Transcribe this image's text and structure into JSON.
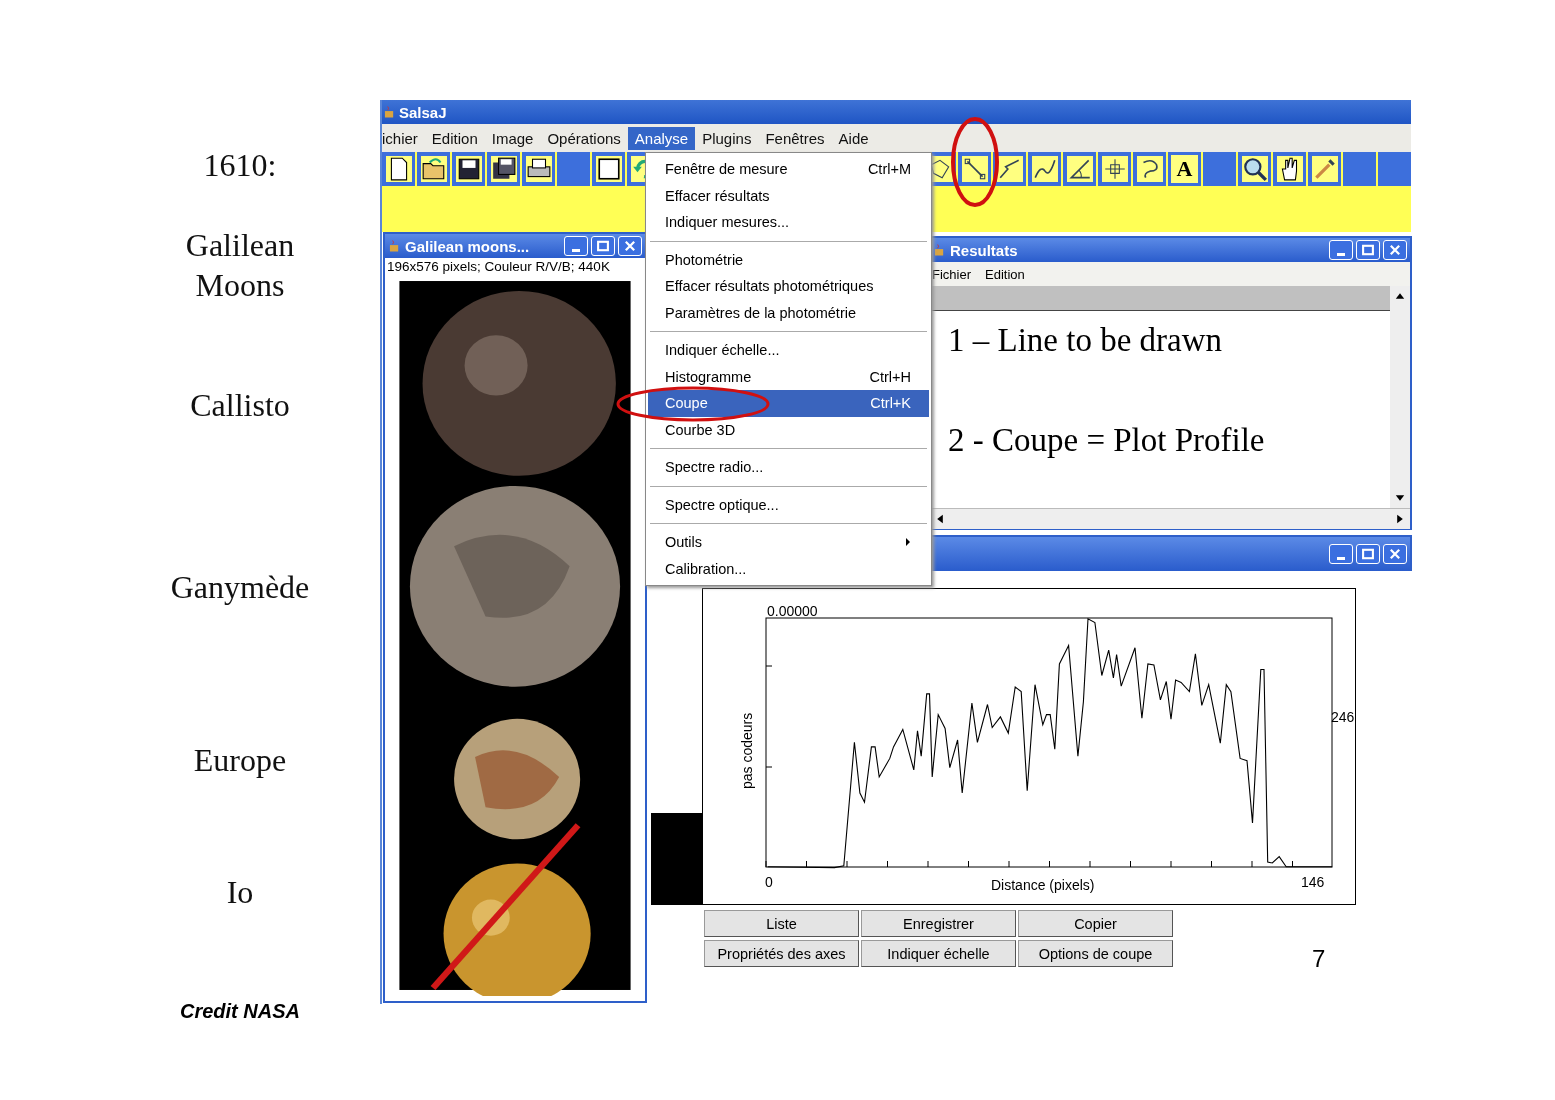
{
  "slide": {
    "year": "1610:",
    "heading": "Galilean Moons",
    "moon_labels": [
      "Callisto",
      "Ganymède",
      "Europe",
      "Io"
    ],
    "credit": "Credit NASA",
    "page_number": "7"
  },
  "app": {
    "title": "SalsaJ",
    "menubar": [
      {
        "label": "ichier",
        "selected": false
      },
      {
        "label": "Edition",
        "selected": false
      },
      {
        "label": "Image",
        "selected": false
      },
      {
        "label": "Opérations",
        "selected": false
      },
      {
        "label": "Analyse",
        "selected": true
      },
      {
        "label": "Plugins",
        "selected": false
      },
      {
        "label": "Fenêtres",
        "selected": false
      },
      {
        "label": "Aide",
        "selected": false
      }
    ],
    "toolbar": {
      "text_tool": "A"
    },
    "analyse_menu": {
      "groups": [
        [
          {
            "label": "Fenêtre de mesure",
            "shortcut": "Ctrl+M",
            "selected": false,
            "kind": "item"
          },
          {
            "label": "Effacer résultats",
            "selected": false,
            "kind": "item"
          },
          {
            "label": "Indiquer mesures...",
            "selected": false,
            "kind": "item"
          }
        ],
        [
          {
            "label": "Photométrie",
            "selected": false,
            "kind": "item"
          },
          {
            "label": "Effacer résultats photométriques",
            "selected": false,
            "kind": "item"
          },
          {
            "label": "Paramètres de la photométrie",
            "selected": false,
            "kind": "item"
          }
        ],
        [
          {
            "label": "Indiquer échelle...",
            "selected": false,
            "kind": "item"
          },
          {
            "label": "Histogramme",
            "shortcut": "Ctrl+H",
            "selected": false,
            "kind": "item"
          },
          {
            "label": "Coupe",
            "shortcut": "Ctrl+K",
            "selected": true,
            "kind": "item"
          },
          {
            "label": "Courbe 3D",
            "selected": false,
            "kind": "item"
          }
        ],
        [
          {
            "label": "Spectre radio...",
            "selected": false,
            "kind": "item"
          }
        ],
        [
          {
            "label": "Spectre optique...",
            "selected": false,
            "kind": "item"
          }
        ],
        [
          {
            "label": "Outils",
            "selected": false,
            "kind": "submenu"
          },
          {
            "label": "Calibration...",
            "selected": false,
            "kind": "item"
          }
        ]
      ]
    },
    "image_window": {
      "title": "Galilean moons...",
      "info": "196x576 pixels; Couleur R/V/B; 440K"
    },
    "results_window": {
      "title": "Resultats",
      "menu": [
        "Fichier",
        "Edition"
      ],
      "lines": [
        "1 – Line to be drawn",
        "2 - Coupe = Plot Profile"
      ]
    },
    "profile_window": {
      "y_top_label": "0.00000",
      "y_right_label": "246",
      "ylabel": "pas codeurs",
      "x_min": "0",
      "xlabel": "Distance (pixels)",
      "x_max": "146",
      "buttons": [
        [
          "Liste",
          "Enregistrer",
          "Copier"
        ],
        [
          "Propriétés des axes",
          "Indiquer échelle",
          "Options de coupe"
        ]
      ]
    }
  }
}
